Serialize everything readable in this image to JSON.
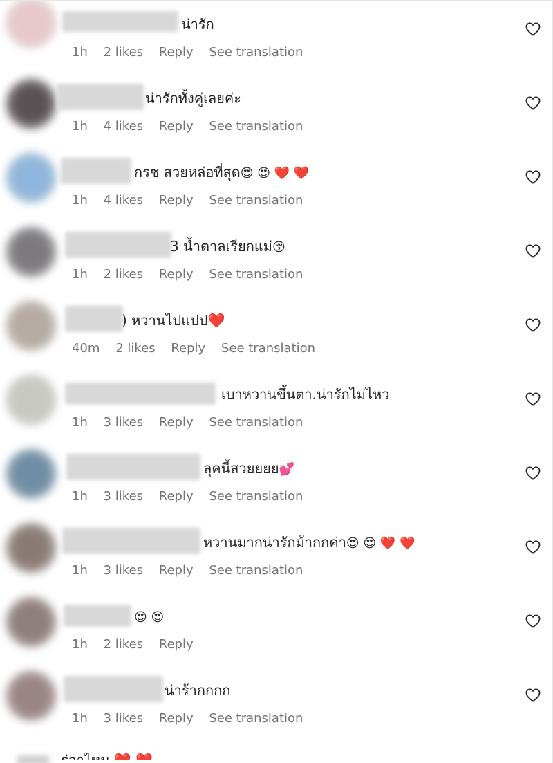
{
  "comments": [
    {
      "text": "น่ารัก",
      "time": "1h",
      "likes": "2 likes",
      "reply": "Reply",
      "translate": "See translation",
      "avatar_color": "#e8c9cb"
    },
    {
      "text": "น่ารักทั้งคู่เลยค่ะ",
      "time": "1h",
      "likes": "4 likes",
      "reply": "Reply",
      "translate": "See translation",
      "avatar_color": "#5a5355"
    },
    {
      "text": "กรช สวยหล่อที่สุด",
      "emoji": "😍 😍 ❤️ ❤️",
      "time": "1h",
      "likes": "4 likes",
      "reply": "Reply",
      "translate": "See translation",
      "avatar_color": "#8fb6dc"
    },
    {
      "text": "3 น้ำตาลเรียกแม่",
      "emoji": "😚",
      "time": "1h",
      "likes": "2 likes",
      "reply": "Reply",
      "translate": "See translation",
      "avatar_color": "#7c7a7d"
    },
    {
      "text": ") หวานไปแปป",
      "emoji": "❤️",
      "time": "40m",
      "likes": "2 likes",
      "reply": "Reply",
      "translate": "See translation",
      "avatar_color": "#b6aba2"
    },
    {
      "text": "เบาหวานขึ้นตา.น่ารักไม่ไหว",
      "time": "1h",
      "likes": "3 likes",
      "reply": "Reply",
      "translate": "See translation",
      "avatar_color": "#c7c9c2"
    },
    {
      "text": "ลุคนี้สวยยยย",
      "emoji": "💕",
      "time": "1h",
      "likes": "3 likes",
      "reply": "Reply",
      "translate": "See translation",
      "avatar_color": "#6f8ea5"
    },
    {
      "text": "หวานมากน่ารักม้ากกค่า",
      "emoji": "😍 😍 ❤️ ❤️",
      "time": "1h",
      "likes": "3 likes",
      "reply": "Reply",
      "translate": "See translation",
      "avatar_color": "#8a7c74"
    },
    {
      "text": "",
      "emoji": "😍 😍",
      "time": "1h",
      "likes": "2 likes",
      "reply": "Reply",
      "translate": "",
      "avatar_color": "#8f7f7a"
    },
    {
      "text": "น่าร้ากกกก",
      "time": "1h",
      "likes": "3 likes",
      "reply": "Reply",
      "translate": "See translation",
      "avatar_color": "#9a8486"
    }
  ],
  "partial_comment": {
    "text": "ร่อาไหม ❤️ ❤️"
  },
  "colors": {
    "heart": "#ef1c2c",
    "meta_text": "#737373",
    "body_text": "#262626"
  },
  "icons": {
    "like": "heart-outline-icon"
  }
}
